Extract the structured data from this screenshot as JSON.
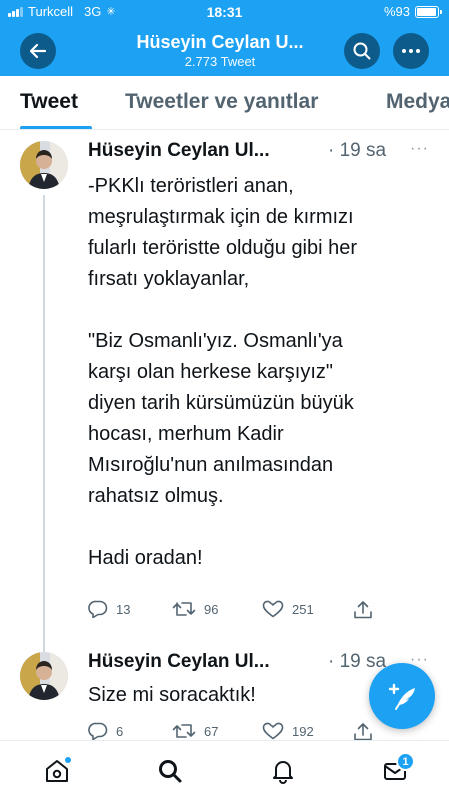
{
  "status_bar": {
    "carrier": "Turkcell",
    "network": "3G",
    "time": "18:31",
    "battery": "%93",
    "battery_level": 0.93
  },
  "header": {
    "title": "Hüseyin Ceylan U...",
    "subtitle": "2.773 Tweet"
  },
  "tabs": [
    {
      "label": "Tweet",
      "active": true
    },
    {
      "label": "Tweetler ve yanıtlar",
      "active": false
    },
    {
      "label": "Medya",
      "active": false
    }
  ],
  "tweets": [
    {
      "author": "Hüseyin Ceylan Ul...",
      "time": "· 19 sa",
      "more": "···",
      "text": "-PKKlı teröristleri anan,\nmeşrulaştırmak için de kırmızı\nfularlı teröristte olduğu gibi her\nfırsatı yoklayanlar,\n\n\"Biz Osmanlı'yız. Osmanlı'ya\nkarşı olan herkese karşıyız\"\ndiyen tarih kürsümüzün büyük\nhocası, merhum Kadir\nMısıroğlu'nun anılmasından\nrahatsız olmuş.\n\nHadi oradan!",
      "replies": "13",
      "retweets": "96",
      "likes": "251"
    },
    {
      "author": "Hüseyin Ceylan Ul...",
      "time": "· 19 sa",
      "more": "···",
      "text": "Size mi soracaktık!",
      "replies": "6",
      "retweets": "67",
      "likes": "192"
    }
  ],
  "bottom_nav": {
    "notification_badge": "1"
  },
  "colors": {
    "accent": "#1da1f2",
    "header_button": "#0c5b8a",
    "secondary_text": "#536471"
  }
}
